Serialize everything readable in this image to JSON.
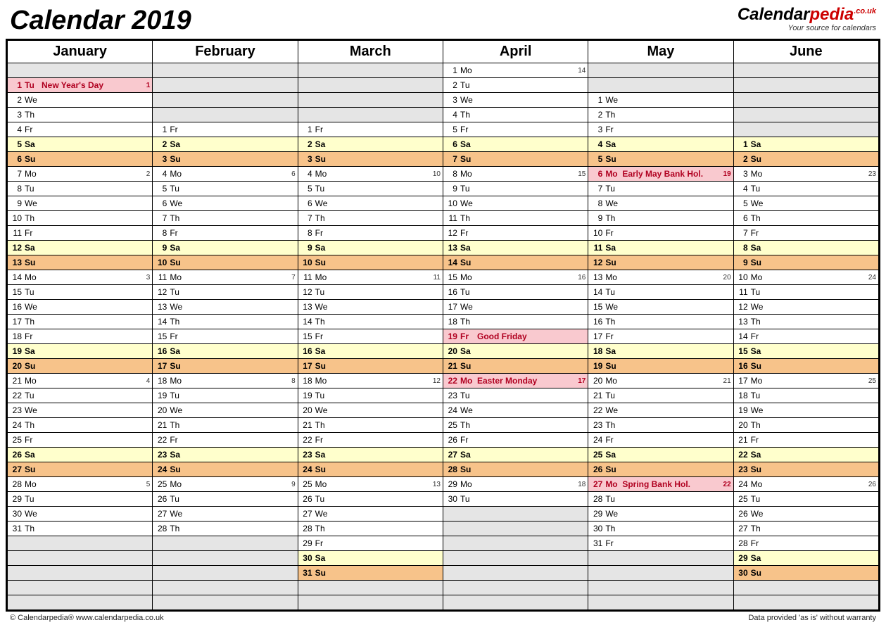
{
  "title": "Calendar 2019",
  "brand": {
    "name_black": "Calendar",
    "name_red": "pedia",
    "sup": ".co.uk",
    "tagline": "Your source for calendars"
  },
  "footer": {
    "left": "© Calendarpedia®   www.calendarpedia.co.uk",
    "right": "Data provided 'as is' without warranty"
  },
  "months": [
    "January",
    "February",
    "March",
    "April",
    "May",
    "June"
  ],
  "rows": 37,
  "columns": [
    {
      "start": 2,
      "days": [
        {
          "n": 1,
          "d": "Tu",
          "hol": "New Year's Day",
          "wk": 1
        },
        {
          "n": 2,
          "d": "We"
        },
        {
          "n": 3,
          "d": "Th"
        },
        {
          "n": 4,
          "d": "Fr"
        },
        {
          "n": 5,
          "d": "Sa"
        },
        {
          "n": 6,
          "d": "Su"
        },
        {
          "n": 7,
          "d": "Mo",
          "wk": 2
        },
        {
          "n": 8,
          "d": "Tu"
        },
        {
          "n": 9,
          "d": "We"
        },
        {
          "n": 10,
          "d": "Th"
        },
        {
          "n": 11,
          "d": "Fr"
        },
        {
          "n": 12,
          "d": "Sa"
        },
        {
          "n": 13,
          "d": "Su"
        },
        {
          "n": 14,
          "d": "Mo",
          "wk": 3
        },
        {
          "n": 15,
          "d": "Tu"
        },
        {
          "n": 16,
          "d": "We"
        },
        {
          "n": 17,
          "d": "Th"
        },
        {
          "n": 18,
          "d": "Fr"
        },
        {
          "n": 19,
          "d": "Sa"
        },
        {
          "n": 20,
          "d": "Su"
        },
        {
          "n": 21,
          "d": "Mo",
          "wk": 4
        },
        {
          "n": 22,
          "d": "Tu"
        },
        {
          "n": 23,
          "d": "We"
        },
        {
          "n": 24,
          "d": "Th"
        },
        {
          "n": 25,
          "d": "Fr"
        },
        {
          "n": 26,
          "d": "Sa"
        },
        {
          "n": 27,
          "d": "Su"
        },
        {
          "n": 28,
          "d": "Mo",
          "wk": 5
        },
        {
          "n": 29,
          "d": "Tu"
        },
        {
          "n": 30,
          "d": "We"
        },
        {
          "n": 31,
          "d": "Th"
        }
      ]
    },
    {
      "start": 5,
      "days": [
        {
          "n": 1,
          "d": "Fr"
        },
        {
          "n": 2,
          "d": "Sa"
        },
        {
          "n": 3,
          "d": "Su"
        },
        {
          "n": 4,
          "d": "Mo",
          "wk": 6
        },
        {
          "n": 5,
          "d": "Tu"
        },
        {
          "n": 6,
          "d": "We"
        },
        {
          "n": 7,
          "d": "Th"
        },
        {
          "n": 8,
          "d": "Fr"
        },
        {
          "n": 9,
          "d": "Sa"
        },
        {
          "n": 10,
          "d": "Su"
        },
        {
          "n": 11,
          "d": "Mo",
          "wk": 7
        },
        {
          "n": 12,
          "d": "Tu"
        },
        {
          "n": 13,
          "d": "We"
        },
        {
          "n": 14,
          "d": "Th"
        },
        {
          "n": 15,
          "d": "Fr"
        },
        {
          "n": 16,
          "d": "Sa"
        },
        {
          "n": 17,
          "d": "Su"
        },
        {
          "n": 18,
          "d": "Mo",
          "wk": 8
        },
        {
          "n": 19,
          "d": "Tu"
        },
        {
          "n": 20,
          "d": "We"
        },
        {
          "n": 21,
          "d": "Th"
        },
        {
          "n": 22,
          "d": "Fr"
        },
        {
          "n": 23,
          "d": "Sa"
        },
        {
          "n": 24,
          "d": "Su"
        },
        {
          "n": 25,
          "d": "Mo",
          "wk": 9
        },
        {
          "n": 26,
          "d": "Tu"
        },
        {
          "n": 27,
          "d": "We"
        },
        {
          "n": 28,
          "d": "Th"
        }
      ]
    },
    {
      "start": 5,
      "days": [
        {
          "n": 1,
          "d": "Fr"
        },
        {
          "n": 2,
          "d": "Sa"
        },
        {
          "n": 3,
          "d": "Su"
        },
        {
          "n": 4,
          "d": "Mo",
          "wk": 10
        },
        {
          "n": 5,
          "d": "Tu"
        },
        {
          "n": 6,
          "d": "We"
        },
        {
          "n": 7,
          "d": "Th"
        },
        {
          "n": 8,
          "d": "Fr"
        },
        {
          "n": 9,
          "d": "Sa"
        },
        {
          "n": 10,
          "d": "Su"
        },
        {
          "n": 11,
          "d": "Mo",
          "wk": 11
        },
        {
          "n": 12,
          "d": "Tu"
        },
        {
          "n": 13,
          "d": "We"
        },
        {
          "n": 14,
          "d": "Th"
        },
        {
          "n": 15,
          "d": "Fr"
        },
        {
          "n": 16,
          "d": "Sa"
        },
        {
          "n": 17,
          "d": "Su"
        },
        {
          "n": 18,
          "d": "Mo",
          "wk": 12
        },
        {
          "n": 19,
          "d": "Tu"
        },
        {
          "n": 20,
          "d": "We"
        },
        {
          "n": 21,
          "d": "Th"
        },
        {
          "n": 22,
          "d": "Fr"
        },
        {
          "n": 23,
          "d": "Sa"
        },
        {
          "n": 24,
          "d": "Su"
        },
        {
          "n": 25,
          "d": "Mo",
          "wk": 13
        },
        {
          "n": 26,
          "d": "Tu"
        },
        {
          "n": 27,
          "d": "We"
        },
        {
          "n": 28,
          "d": "Th"
        },
        {
          "n": 29,
          "d": "Fr"
        },
        {
          "n": 30,
          "d": "Sa"
        },
        {
          "n": 31,
          "d": "Su"
        }
      ]
    },
    {
      "start": 1,
      "days": [
        {
          "n": 1,
          "d": "Mo",
          "wk": 14
        },
        {
          "n": 2,
          "d": "Tu"
        },
        {
          "n": 3,
          "d": "We"
        },
        {
          "n": 4,
          "d": "Th"
        },
        {
          "n": 5,
          "d": "Fr"
        },
        {
          "n": 6,
          "d": "Sa"
        },
        {
          "n": 7,
          "d": "Su"
        },
        {
          "n": 8,
          "d": "Mo",
          "wk": 15
        },
        {
          "n": 9,
          "d": "Tu"
        },
        {
          "n": 10,
          "d": "We"
        },
        {
          "n": 11,
          "d": "Th"
        },
        {
          "n": 12,
          "d": "Fr"
        },
        {
          "n": 13,
          "d": "Sa"
        },
        {
          "n": 14,
          "d": "Su"
        },
        {
          "n": 15,
          "d": "Mo",
          "wk": 16
        },
        {
          "n": 16,
          "d": "Tu"
        },
        {
          "n": 17,
          "d": "We"
        },
        {
          "n": 18,
          "d": "Th"
        },
        {
          "n": 19,
          "d": "Fr",
          "hol": "Good Friday"
        },
        {
          "n": 20,
          "d": "Sa"
        },
        {
          "n": 21,
          "d": "Su"
        },
        {
          "n": 22,
          "d": "Mo",
          "hol": "Easter Monday",
          "wk": 17
        },
        {
          "n": 23,
          "d": "Tu"
        },
        {
          "n": 24,
          "d": "We"
        },
        {
          "n": 25,
          "d": "Th"
        },
        {
          "n": 26,
          "d": "Fr"
        },
        {
          "n": 27,
          "d": "Sa"
        },
        {
          "n": 28,
          "d": "Su"
        },
        {
          "n": 29,
          "d": "Mo",
          "wk": 18
        },
        {
          "n": 30,
          "d": "Tu"
        }
      ]
    },
    {
      "start": 3,
      "days": [
        {
          "n": 1,
          "d": "We"
        },
        {
          "n": 2,
          "d": "Th"
        },
        {
          "n": 3,
          "d": "Fr"
        },
        {
          "n": 4,
          "d": "Sa"
        },
        {
          "n": 5,
          "d": "Su"
        },
        {
          "n": 6,
          "d": "Mo",
          "hol": "Early May Bank Hol.",
          "wk": 19
        },
        {
          "n": 7,
          "d": "Tu"
        },
        {
          "n": 8,
          "d": "We"
        },
        {
          "n": 9,
          "d": "Th"
        },
        {
          "n": 10,
          "d": "Fr"
        },
        {
          "n": 11,
          "d": "Sa"
        },
        {
          "n": 12,
          "d": "Su"
        },
        {
          "n": 13,
          "d": "Mo",
          "wk": 20
        },
        {
          "n": 14,
          "d": "Tu"
        },
        {
          "n": 15,
          "d": "We"
        },
        {
          "n": 16,
          "d": "Th"
        },
        {
          "n": 17,
          "d": "Fr"
        },
        {
          "n": 18,
          "d": "Sa"
        },
        {
          "n": 19,
          "d": "Su"
        },
        {
          "n": 20,
          "d": "Mo",
          "wk": 21
        },
        {
          "n": 21,
          "d": "Tu"
        },
        {
          "n": 22,
          "d": "We"
        },
        {
          "n": 23,
          "d": "Th"
        },
        {
          "n": 24,
          "d": "Fr"
        },
        {
          "n": 25,
          "d": "Sa"
        },
        {
          "n": 26,
          "d": "Su"
        },
        {
          "n": 27,
          "d": "Mo",
          "hol": "Spring Bank Hol.",
          "wk": 22
        },
        {
          "n": 28,
          "d": "Tu"
        },
        {
          "n": 29,
          "d": "We"
        },
        {
          "n": 30,
          "d": "Th"
        },
        {
          "n": 31,
          "d": "Fr"
        }
      ]
    },
    {
      "start": 6,
      "days": [
        {
          "n": 1,
          "d": "Sa"
        },
        {
          "n": 2,
          "d": "Su"
        },
        {
          "n": 3,
          "d": "Mo",
          "wk": 23
        },
        {
          "n": 4,
          "d": "Tu"
        },
        {
          "n": 5,
          "d": "We"
        },
        {
          "n": 6,
          "d": "Th"
        },
        {
          "n": 7,
          "d": "Fr"
        },
        {
          "n": 8,
          "d": "Sa"
        },
        {
          "n": 9,
          "d": "Su"
        },
        {
          "n": 10,
          "d": "Mo",
          "wk": 24
        },
        {
          "n": 11,
          "d": "Tu"
        },
        {
          "n": 12,
          "d": "We"
        },
        {
          "n": 13,
          "d": "Th"
        },
        {
          "n": 14,
          "d": "Fr"
        },
        {
          "n": 15,
          "d": "Sa"
        },
        {
          "n": 16,
          "d": "Su"
        },
        {
          "n": 17,
          "d": "Mo",
          "wk": 25
        },
        {
          "n": 18,
          "d": "Tu"
        },
        {
          "n": 19,
          "d": "We"
        },
        {
          "n": 20,
          "d": "Th"
        },
        {
          "n": 21,
          "d": "Fr"
        },
        {
          "n": 22,
          "d": "Sa"
        },
        {
          "n": 23,
          "d": "Su"
        },
        {
          "n": 24,
          "d": "Mo",
          "wk": 26
        },
        {
          "n": 25,
          "d": "Tu"
        },
        {
          "n": 26,
          "d": "We"
        },
        {
          "n": 27,
          "d": "Th"
        },
        {
          "n": 28,
          "d": "Fr"
        },
        {
          "n": 29,
          "d": "Sa"
        },
        {
          "n": 30,
          "d": "Su"
        }
      ]
    }
  ]
}
